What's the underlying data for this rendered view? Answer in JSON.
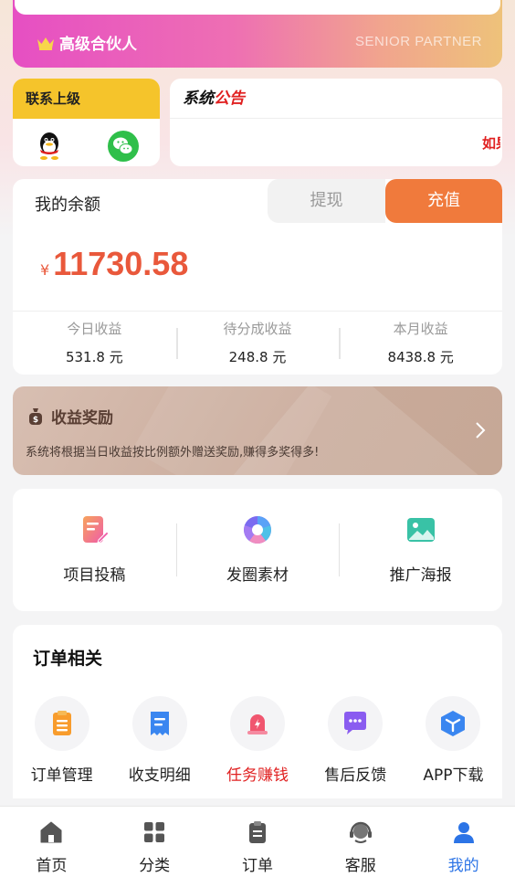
{
  "partner": {
    "title": "高级合伙人",
    "subtitle": "SENIOR PARTNER"
  },
  "contact": {
    "title": "联系上级",
    "icons": [
      "qq-icon",
      "wechat-icon"
    ]
  },
  "notice": {
    "title_part1": "系统",
    "title_part2": "公告",
    "marquee": "如果"
  },
  "balance": {
    "label": "我的余额",
    "withdraw_label": "提现",
    "recharge_label": "充值",
    "currency": "¥",
    "amount": "11730.58",
    "stats": [
      {
        "label": "今日收益",
        "value": "531.8 元"
      },
      {
        "label": "待分成收益",
        "value": "248.8 元"
      },
      {
        "label": "本月收益",
        "value": "8438.8 元"
      }
    ]
  },
  "reward": {
    "title": "收益奖励",
    "description": "系统将根据当日收益按比例额外赠送奖励,赚得多奖得多!"
  },
  "tools": [
    {
      "label": "项目投稿",
      "icon": "document-edit-icon"
    },
    {
      "label": "发圈素材",
      "icon": "aperture-icon"
    },
    {
      "label": "推广海报",
      "icon": "image-icon"
    }
  ],
  "orders": {
    "title": "订单相关",
    "items": [
      {
        "label": "订单管理",
        "icon": "order-list-icon"
      },
      {
        "label": "收支明细",
        "icon": "receipt-icon"
      },
      {
        "label": "任务赚钱",
        "icon": "alarm-task-icon"
      },
      {
        "label": "售后反馈",
        "icon": "chat-bubble-icon"
      },
      {
        "label": "APP下载",
        "icon": "cube-icon"
      }
    ]
  },
  "tabs": [
    {
      "label": "首页",
      "icon": "home-icon"
    },
    {
      "label": "分类",
      "icon": "grid-icon"
    },
    {
      "label": "订单",
      "icon": "clipboard-icon"
    },
    {
      "label": "客服",
      "icon": "headset-icon"
    },
    {
      "label": "我的",
      "icon": "user-icon"
    }
  ],
  "colors": {
    "accent": "#f07a3c",
    "amount": "#e9583b",
    "active_tab": "#2c74e6",
    "alert": "#e02020"
  }
}
